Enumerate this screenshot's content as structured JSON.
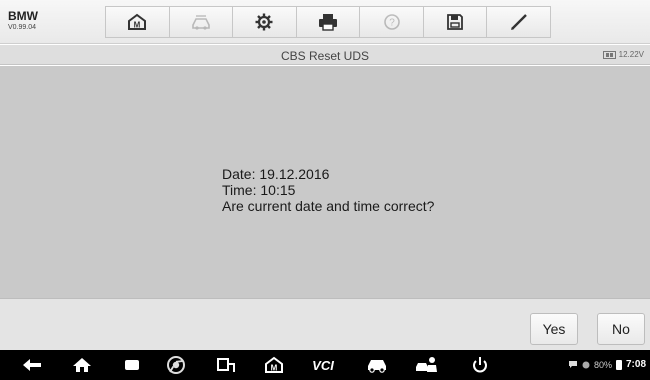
{
  "app": {
    "brand": "BMW",
    "version": "V0.99.04"
  },
  "toolbar": {
    "items": [
      {
        "icon": "home-icon",
        "enabled": true
      },
      {
        "icon": "vehicle-swap-icon",
        "enabled": false
      },
      {
        "icon": "gear-icon",
        "enabled": true
      },
      {
        "icon": "printer-icon",
        "enabled": true
      },
      {
        "icon": "help-icon",
        "enabled": false
      },
      {
        "icon": "save-icon",
        "enabled": true
      },
      {
        "icon": "pen-icon",
        "enabled": true
      }
    ]
  },
  "titlebar": {
    "title": "CBS Reset UDS",
    "voltage": "12.22V"
  },
  "message": {
    "line1": "Date: 19.12.2016",
    "line2": "Time: 10:15",
    "line3": "Are current date and time correct?"
  },
  "actions": {
    "yes": "Yes",
    "no": "No"
  },
  "navbar": {
    "icons": [
      "back-icon",
      "home-icon",
      "recent-apps-icon",
      "chrome-icon",
      "vci-connect-icon",
      "autel-home-icon",
      "vci-icon",
      "car-icon",
      "mechanic-icon",
      "power-icon"
    ],
    "vci_label": "VCI",
    "battery": "80%",
    "clock": "7:08"
  }
}
